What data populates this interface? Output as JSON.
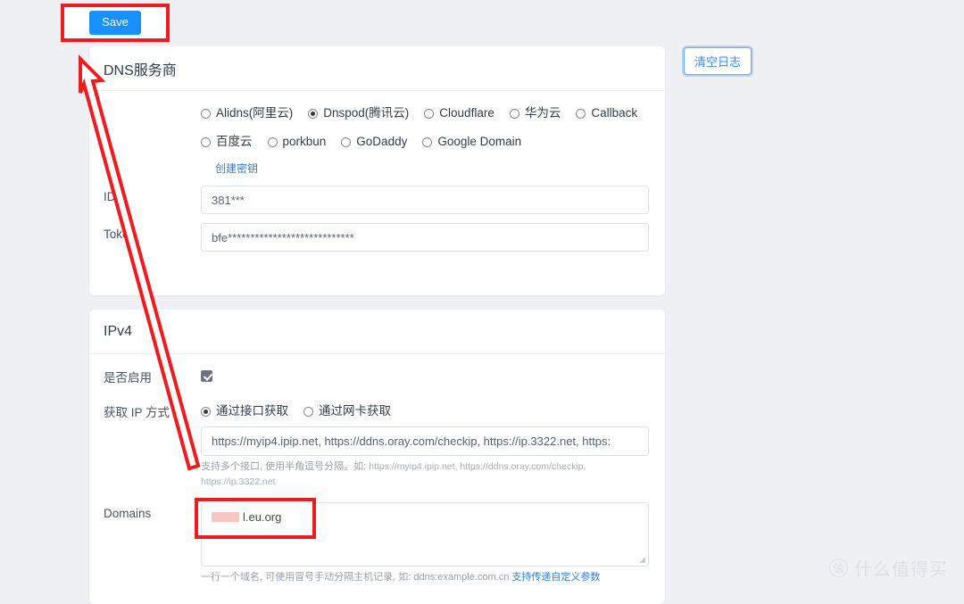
{
  "toolbar": {
    "save_label": "Save",
    "clear_log_label": "清空日志"
  },
  "cards": {
    "dns": {
      "title": "DNS服务商",
      "providers_row1": [
        {
          "label": "Alidns(阿里云)",
          "selected": false
        },
        {
          "label": "Dnspod(腾讯云)",
          "selected": true
        },
        {
          "label": "Cloudflare",
          "selected": false
        },
        {
          "label": "华为云",
          "selected": false
        },
        {
          "label": "Callback",
          "selected": false
        }
      ],
      "providers_row2": [
        {
          "label": "百度云",
          "selected": false
        },
        {
          "label": "porkbun",
          "selected": false
        },
        {
          "label": "GoDaddy",
          "selected": false
        },
        {
          "label": "Google Domain",
          "selected": false
        }
      ],
      "create_key_link": "创建密钥",
      "id_label": "ID",
      "id_value": "381***",
      "token_label": "Token",
      "token_value": "bfe****************************"
    },
    "ipv4": {
      "title": "IPv4",
      "enable_label": "是否启用",
      "enable_checked": true,
      "get_ip_label": "获取 IP 方式",
      "get_ip_options": [
        {
          "label": "通过接口获取",
          "selected": true
        },
        {
          "label": "通过网卡获取",
          "selected": false
        }
      ],
      "url_value": "https://myip4.ipip.net, https://ddns.oray.com/checkip, https://ip.3322.net, https:",
      "url_hint_prefix": "支持多个接口, 使用半角逗号分隔。如:",
      "url_hint_examples": "https://myip4.ipip.net, https://ddns.oray.com/checkip, https://ip.3322.net",
      "domains_label": "Domains",
      "domains_value": "l.eu.org",
      "domains_redacted": true,
      "domains_hint": "一行一个域名, 可使用冒号手动分隔主机记录, 如: ddns:example.com.cn",
      "domains_hint_link": "支持传递自定义参数"
    }
  },
  "annotations": {
    "save_box": "highlight-save-button",
    "domain_box": "highlight-domain-entry",
    "arrow": "arrow-pointing-to-save"
  },
  "watermark": {
    "logo_glyph": "值",
    "text": "什么值得买"
  },
  "colors": {
    "accent": "#1890ff",
    "annotation": "#ee1c20",
    "link": "#2f7fe0",
    "page_bg": "#eef0f4"
  }
}
